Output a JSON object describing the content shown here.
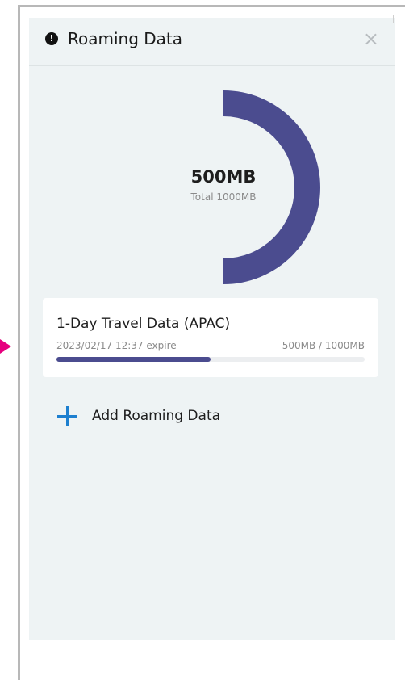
{
  "header": {
    "title": "Roaming Data",
    "close_glyph": "×",
    "alert_glyph": "!"
  },
  "gauge": {
    "amount_label": "500MB",
    "total_label": "Total 1000MB",
    "used_mb": 500,
    "total_mb": 1000,
    "fraction": 0.5,
    "color": "#4b4c8f"
  },
  "plan": {
    "name": "1-Day Travel Data (APAC)",
    "expire": "2023/02/17 12:37 expire",
    "usage": "500MB / 1000MB",
    "progress_fraction": 0.5,
    "progress_color": "#4b4c8f"
  },
  "actions": {
    "add_label": "Add Roaming Data",
    "plus_icon_color": "#1d7fcf"
  },
  "annotation": {
    "arrow_color": "#e6007e"
  }
}
